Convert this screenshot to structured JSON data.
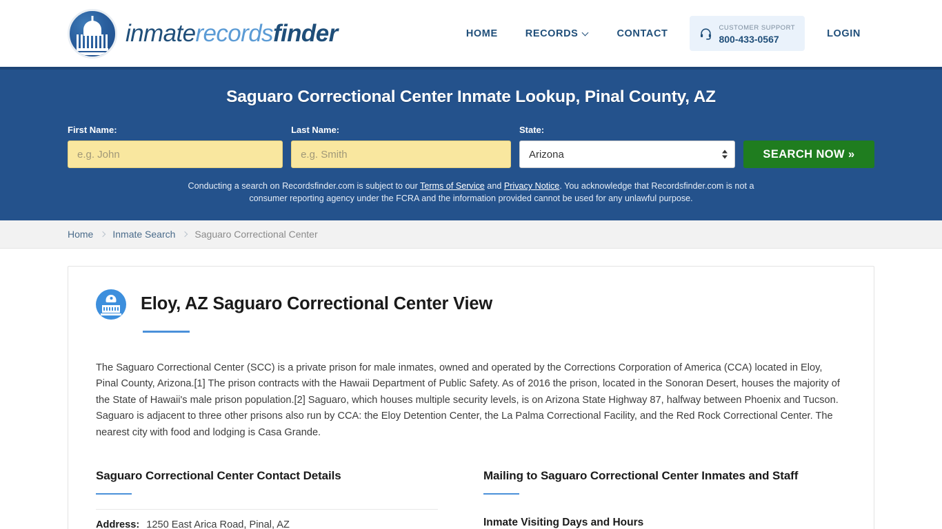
{
  "header": {
    "logo": {
      "part1": "inmate",
      "part2": "records",
      "part3": "finder",
      "icon": "capitol-dome-icon"
    },
    "nav": [
      {
        "label": "HOME",
        "name": "nav-home"
      },
      {
        "label": "RECORDS",
        "name": "nav-records",
        "has_dropdown": true
      },
      {
        "label": "CONTACT",
        "name": "nav-contact"
      }
    ],
    "support": {
      "icon": "headset-icon",
      "label": "CUSTOMER SUPPORT",
      "phone": "800-433-0567"
    },
    "login_label": "LOGIN"
  },
  "hero": {
    "title": "Saguaro Correctional Center Inmate Lookup, Pinal County, AZ",
    "fields": {
      "first_name_label": "First Name:",
      "first_name_placeholder": "e.g. John",
      "first_name_value": "",
      "last_name_label": "Last Name:",
      "last_name_placeholder": "e.g. Smith",
      "last_name_value": "",
      "state_label": "State:",
      "state_value": "Arizona",
      "state_options": [
        "Arizona"
      ]
    },
    "search_button": "SEARCH NOW »",
    "disclaimer": {
      "text_1": "Conducting a search on Recordsfinder.com is subject to our ",
      "link_1": "Terms of Service",
      "text_2": " and ",
      "link_2": "Privacy Notice",
      "text_3": ". You acknowledge that Recordsfinder.com is not a consumer reporting agency under the FCRA and the information provided cannot be used for any unlawful purpose."
    },
    "colors": {
      "background": "#24528c",
      "button": "#1f7d1f",
      "input": "#f9e79f"
    }
  },
  "breadcrumb": [
    {
      "label": "Home",
      "current": false
    },
    {
      "label": "Inmate Search",
      "current": false
    },
    {
      "label": "Saguaro Correctional Center",
      "current": true
    }
  ],
  "main": {
    "badge_icon": "courthouse-icon",
    "page_title": "Eloy, AZ Saguaro Correctional Center View",
    "description": "The Saguaro Correctional Center (SCC) is a private prison for male inmates, owned and operated by the Corrections Corporation of America (CCA) located in Eloy, Pinal County, Arizona.[1] The prison contracts with the Hawaii Department of Public Safety. As of 2016 the prison, located in the Sonoran Desert, houses the majority of the State of Hawaii's male prison population.[2] Saguaro, which houses multiple security levels, is on Arizona State Highway 87, halfway between Phoenix and Tucson. Saguaro is adjacent to three other prisons also run by CCA: the Eloy Detention Center, the La Palma Correctional Facility, and the Red Rock Correctional Center. The nearest city with food and lodging is Casa Grande.",
    "left_column": {
      "heading": "Saguaro Correctional Center Contact Details",
      "rows": [
        {
          "key": "Address:",
          "value": "1250 East Arica Road, Pinal, AZ"
        }
      ]
    },
    "right_column": {
      "heading": "Mailing to Saguaro Correctional Center Inmates and Staff",
      "sub_heading": "Inmate Visiting Days and Hours"
    },
    "accent_color": "#4a90d9"
  }
}
